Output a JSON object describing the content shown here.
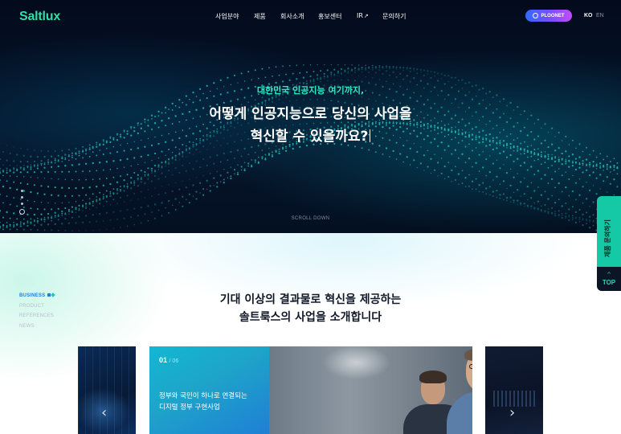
{
  "header": {
    "logo": "Saltlux",
    "nav": [
      {
        "label": "사업분야"
      },
      {
        "label": "제품"
      },
      {
        "label": "회사소개"
      },
      {
        "label": "홍보센터"
      },
      {
        "label": "IR"
      },
      {
        "label": "문의하기"
      }
    ],
    "ir_arrow": "↗",
    "ploonet_button": "PLOONET",
    "lang_ko": "KO",
    "lang_en": "EN"
  },
  "hero": {
    "subtitle": "대한민국 인공지능 여기까지,",
    "title_line1": "어떻게 인공지능으로 당신의 사업을",
    "title_line2": "혁신할 수 있을까요?",
    "scroll_label": "SCROLL DOWN",
    "accent_color": "#35e6c4"
  },
  "side_buttons": {
    "inquiry_label": "제품 문의하기",
    "top_label": "TOP",
    "top_chevron": "^"
  },
  "section": {
    "side_menu": [
      {
        "label": "BUSINESS",
        "active": true
      },
      {
        "label": "PRODUCT",
        "active": false
      },
      {
        "label": "REFERENCES",
        "active": false
      },
      {
        "label": "NEWS",
        "active": false
      }
    ],
    "title_line1": "기대 이상의 결과물로 혁신을 제공하는",
    "title_line2": "솔트룩스의 사업을 소개합니다"
  },
  "carousel": {
    "current": "01",
    "total": "/ 06",
    "card_text_line1": "정부와 국민이 하나로 연결되는",
    "card_text_line2": "디지털 정부 구현사업",
    "prev_icon": "‹",
    "next_icon": "›"
  },
  "colors": {
    "brand": "#2fe0a4",
    "side_inquiry": "#16c9a6",
    "card_panel": "#1ea3c9"
  }
}
